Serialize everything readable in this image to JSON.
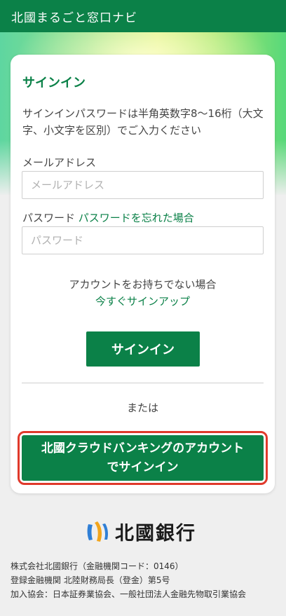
{
  "header": {
    "title": "北國まるごと窓口ナビ"
  },
  "signin": {
    "title": "サインイン",
    "description": "サインインパスワードは半角英数字8〜16桁（大文字、小文字を区別）でご入力ください",
    "email_label": "メールアドレス",
    "email_placeholder": "メールアドレス",
    "password_label": "パスワード",
    "forgot_password": "パスワードを忘れた場合",
    "password_placeholder": "パスワード",
    "no_account": "アカウントをお持ちでない場合",
    "signup_link": "今すぐサインアップ",
    "signin_button": "サインイン",
    "or_text": "または",
    "bank_signin_button": "北國クラウドバンキングのアカウントでサインイン"
  },
  "footer": {
    "bank_name": "北國銀行",
    "lines": [
      "株式会社北國銀行（金融機関コード：0146）",
      "登録金融機関 北陸財務局長（登金）第5号",
      "加入協会：日本証券業協会、一般社団法人金融先物取引業協会"
    ]
  },
  "colors": {
    "brand_green": "#0b8148",
    "highlight_red": "#e0392b"
  }
}
